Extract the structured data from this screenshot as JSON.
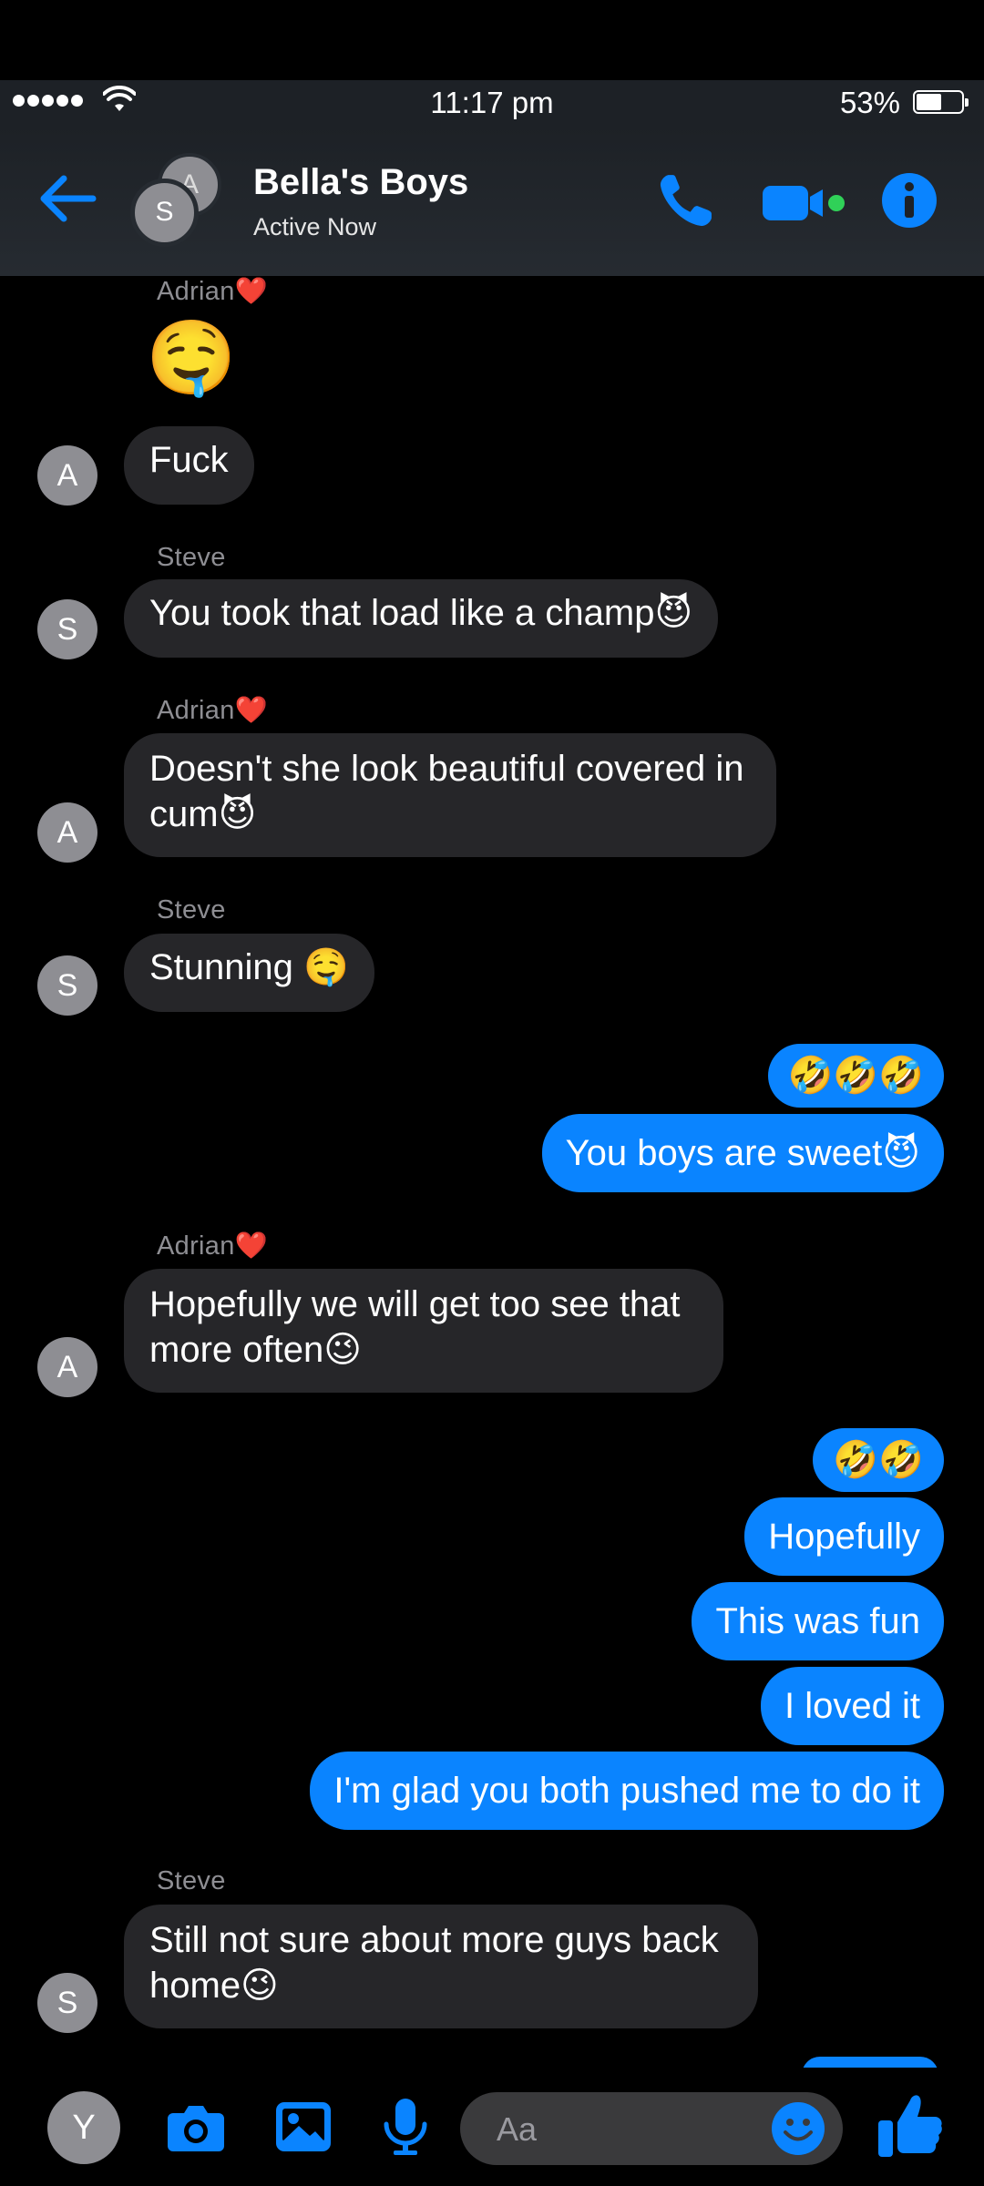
{
  "status": {
    "time": "11:17 pm",
    "battery": "53%",
    "battery_level": 0.53
  },
  "header": {
    "title": "Bella's Boys",
    "subtitle": "Active Now",
    "avatar_back_initial": "A",
    "avatar_front_initial": "S"
  },
  "messages": [
    {
      "sender": "Adrian❤️",
      "avatar": "A",
      "emoji": "🤤",
      "text": "Fuck"
    },
    {
      "sender": "Steve",
      "avatar": "S",
      "text": "You took that load like a champ😈"
    },
    {
      "sender": "Adrian❤️",
      "avatar": "A",
      "line1": "Doesn't she look beautiful covered in",
      "line2": "cum😈"
    },
    {
      "sender": "Steve",
      "avatar": "S",
      "text": "Stunning 🤤"
    },
    {
      "out1": "🤣🤣🤣",
      "out2": "You boys are sweet😈"
    },
    {
      "sender": "Adrian❤️",
      "avatar": "A",
      "line1": "Hopefully we will get too see that",
      "line2": "more often😉"
    },
    {
      "out1": "🤣🤣",
      "out2": "Hopefully",
      "out3": "This was fun",
      "out4": "I loved it",
      "out5": "I'm glad you both pushed me to do it"
    },
    {
      "sender": "Steve",
      "avatar": "S",
      "line1": "Still not sure about more guys back",
      "line2": "home😉"
    }
  ],
  "composer": {
    "me_initial": "Y",
    "placeholder": "Aa"
  },
  "colors": {
    "accent": "#0a84ff",
    "bubble_in": "#262629",
    "header_bg": "#262b31",
    "online": "#30d158"
  },
  "icons": [
    "back-arrow-icon",
    "phone-icon",
    "video-icon",
    "info-icon",
    "camera-icon",
    "photo-icon",
    "microphone-icon",
    "emoji-icon",
    "thumbs-up-icon",
    "wifi-icon"
  ]
}
